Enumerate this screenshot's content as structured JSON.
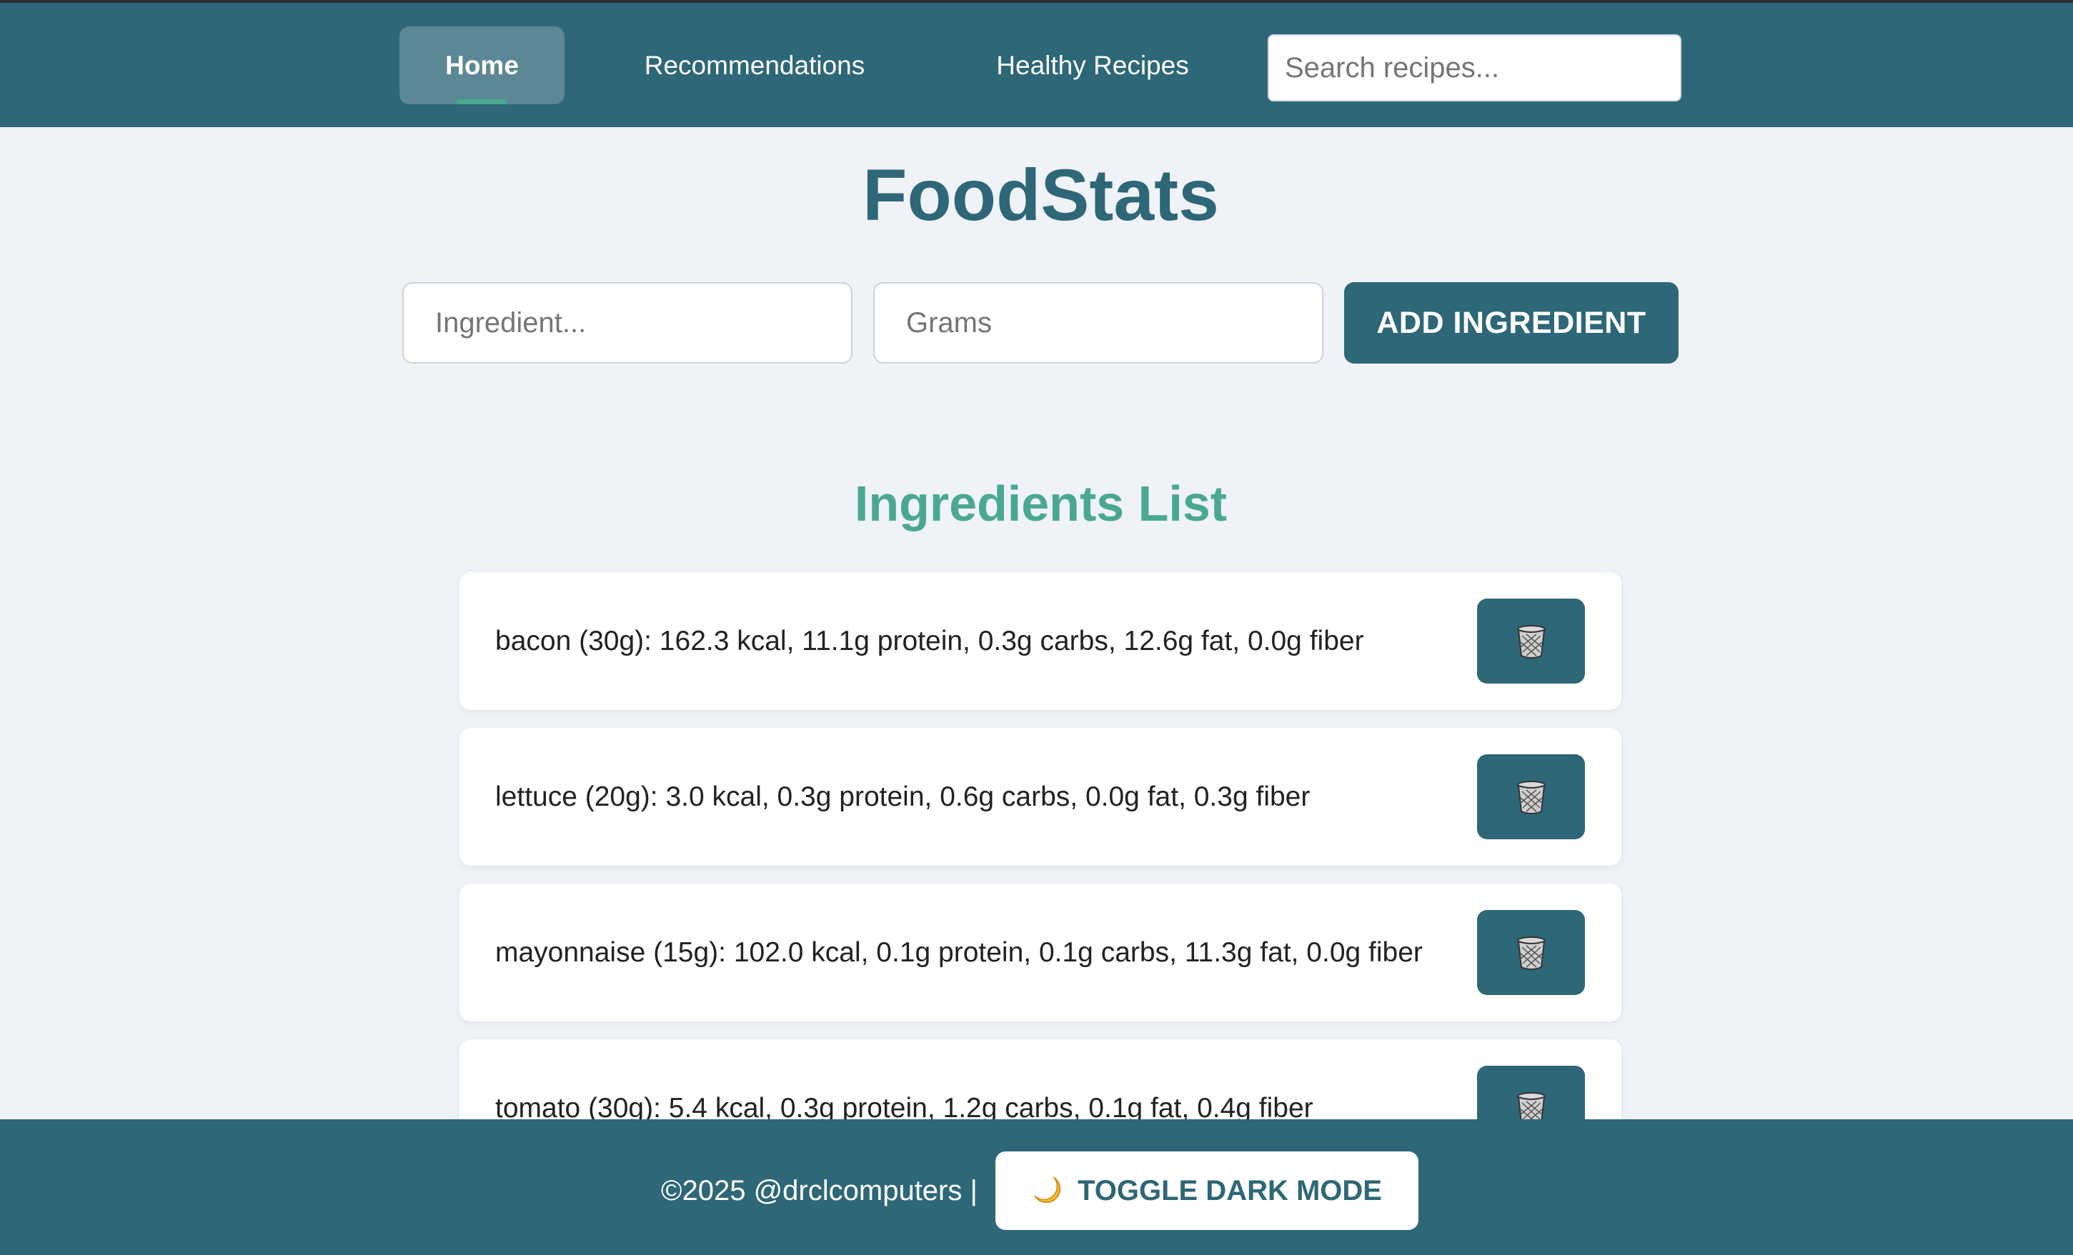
{
  "nav": {
    "home_label": "Home",
    "recommendations_label": "Recommendations",
    "healthy_recipes_label": "Healthy Recipes",
    "search_placeholder": "Search recipes..."
  },
  "app_title": "FoodStats",
  "form": {
    "ingredient_placeholder": "Ingredient...",
    "grams_placeholder": "Grams",
    "add_button_label": "ADD INGREDIENT"
  },
  "ingredients_section": {
    "title": "Ingredients List",
    "items": [
      {
        "text": "bacon (30g): 162.3 kcal, 11.1g protein, 0.3g carbs, 12.6g fat, 0.0g fiber",
        "delete_icon": "trash-icon"
      },
      {
        "text": "lettuce (20g): 3.0 kcal, 0.3g protein, 0.6g carbs, 0.0g fat, 0.3g fiber",
        "delete_icon": "trash-icon"
      },
      {
        "text": "mayonnaise (15g): 102.0 kcal, 0.1g protein, 0.1g carbs, 11.3g fat, 0.0g fiber",
        "delete_icon": "trash-icon"
      },
      {
        "text": "tomato (30g): 5.4 kcal, 0.3g protein, 1.2g carbs, 0.1g fat, 0.4g fiber",
        "delete_icon": "trash-icon"
      }
    ]
  },
  "footer": {
    "copyright": "©2025 @drclcomputers |",
    "toggle_label": "TOGGLE DARK MODE",
    "toggle_icon": "crescent-moon-icon"
  },
  "colors": {
    "primary": "#2e6777",
    "accent": "#4aa891",
    "background": "#eff2f7"
  }
}
